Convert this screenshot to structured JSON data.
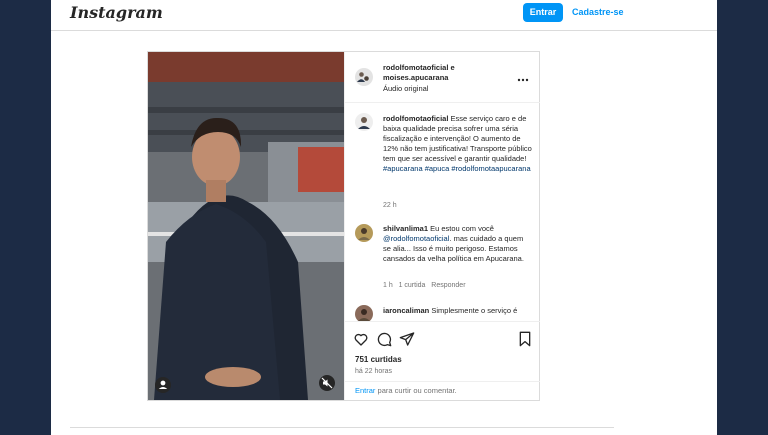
{
  "header": {
    "logo": "Instagram",
    "login_label": "Entrar",
    "signup_label": "Cadastre-se"
  },
  "post": {
    "author1": "rodolfomotaoficial",
    "connector": "e",
    "author2": "moises.apucarana",
    "audio": "Áudio original",
    "caption": {
      "user": "rodolfomotaoficial",
      "text": "Esse serviço caro e de baixa qualidade precisa sofrer uma séria fiscalização e intervenção! O aumento de 12% não tem justificativa! Transporte público tem que ser acessível e garantir qualidade!",
      "hashtags": "#apucarana #apuca #rodolfomotaapucarana",
      "time": "22 h"
    },
    "comments": [
      {
        "user": "shilvanlima1",
        "text_a": "Eu estou com você",
        "mention": "@rodolfomotaoficial",
        "text_b": ". mas cuidado a quem se alia... Isso é muito perigoso. Estamos cansados da velha política em Apucarana.",
        "time": "1 h",
        "likes": "1 curtida",
        "reply": "Responder"
      },
      {
        "user": "iaroncaliman",
        "text": "Simplesmente o serviço é"
      }
    ],
    "likes_count": "751 curtidas",
    "posted_ago": "há 22 horas",
    "login_prompt_link": "Entrar",
    "login_prompt_text": "para curtir ou comentar."
  },
  "icons": [
    "more-icon",
    "heart-icon",
    "comment-icon",
    "share-icon",
    "bookmark-icon",
    "mute-icon",
    "user-tag-icon"
  ],
  "colors": {
    "accent": "#0095f6",
    "background": "#1c2b45"
  }
}
